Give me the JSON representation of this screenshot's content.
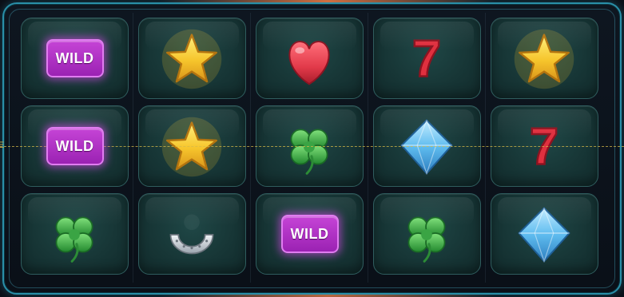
{
  "game": {
    "grid": {
      "columns": 5,
      "rows": 3,
      "cells": [
        [
          "wild",
          "star",
          "heart",
          "seven",
          "star"
        ],
        [
          "wild",
          "star",
          "clover",
          "diamond",
          "seven"
        ],
        [
          "clover",
          "horseshoe",
          "wild",
          "clover",
          "diamond"
        ]
      ]
    },
    "wild_label": "WILD",
    "seven_label": "7",
    "payline": {
      "row": 2,
      "label_fragment": "E"
    }
  },
  "colors": {
    "frame_border": "#2a8fa8",
    "cell_bg": "#173636",
    "wild_bg": "#b031c6",
    "star": "#f6c52c",
    "heart": "#e23a4a",
    "seven": "#e0303f",
    "clover": "#3cb04a",
    "diamond": "#5fbcef",
    "horseshoe": "#c9cfd6",
    "payline": "#d6ba48"
  },
  "icons": {
    "wild": "wild-icon",
    "star": "star-icon",
    "heart": "heart-icon",
    "seven": "seven-icon",
    "clover": "clover-icon",
    "diamond": "diamond-icon",
    "horseshoe": "horseshoe-icon"
  }
}
